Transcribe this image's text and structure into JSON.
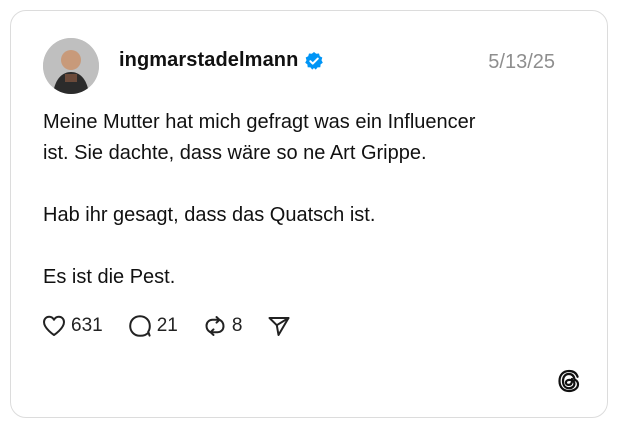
{
  "post": {
    "username": "ingmarstadelmann",
    "verified": true,
    "date": "5/13/25",
    "text": "Meine Mutter hat mich gefragt was ein Influencer\nist. Sie dachte, dass wäre so ne Art Grippe.\n\nHab ihr gesagt, dass das Quatsch ist.\n\nEs ist die Pest.",
    "likes": "631",
    "comments": "21",
    "reposts": "8"
  },
  "icons": {
    "like": "heart-icon",
    "comment": "comment-bubble-icon",
    "repost": "repost-icon",
    "share": "send-icon",
    "verified": "verified-badge-icon",
    "brand": "threads-logo-icon"
  },
  "colors": {
    "verified": "#0095f6",
    "muted": "#8e8e8e",
    "border": "#dcdcdc"
  }
}
